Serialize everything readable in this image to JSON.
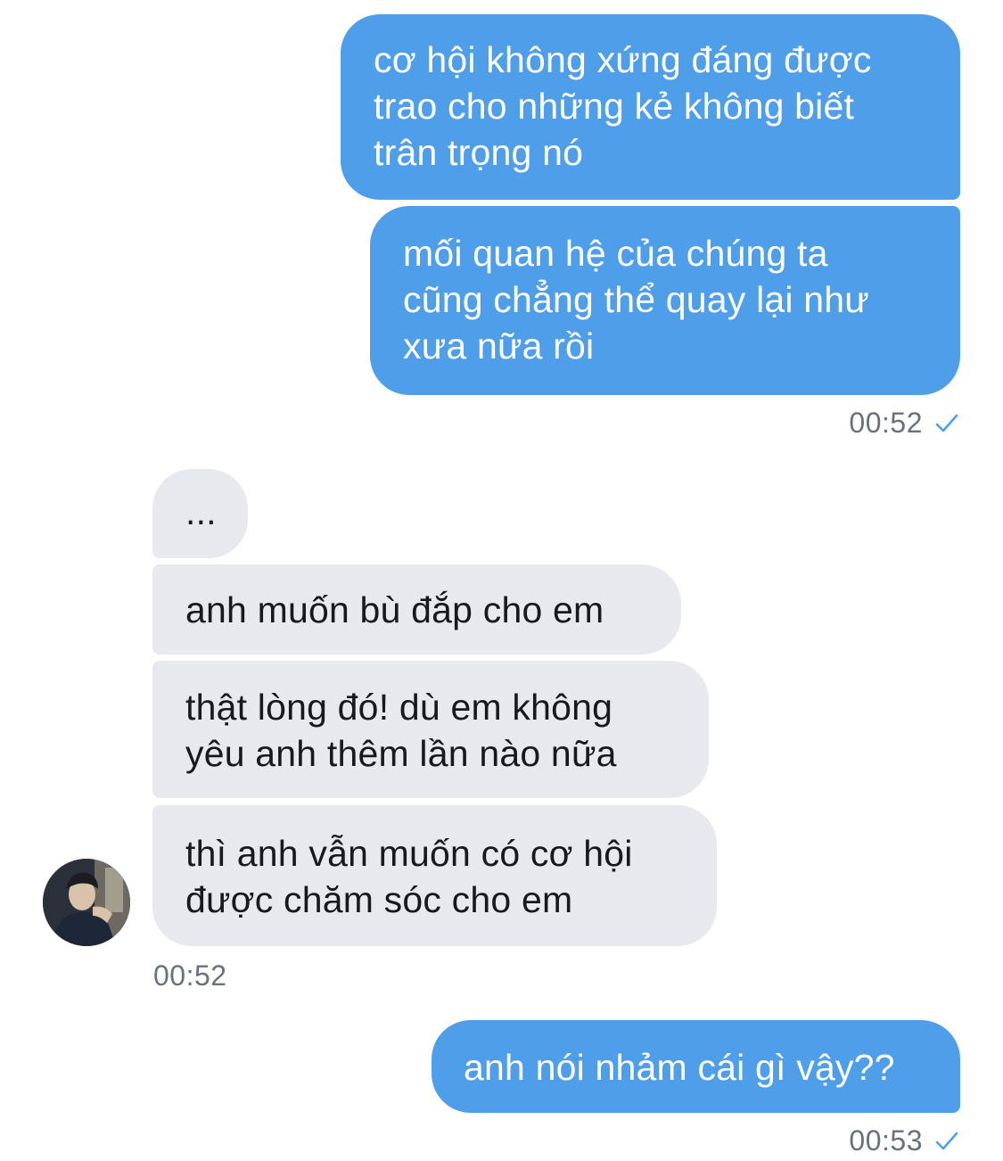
{
  "colors": {
    "outgoing_bubble": "#4e9ee9",
    "incoming_bubble": "#e7e9ee",
    "read_check": "#4e9ee9",
    "timestamp": "#69717a"
  },
  "messages": [
    {
      "text": "cơ hội không xứng đáng được\ntrao cho những kẻ không biết\ntrân trọng nó"
    },
    {
      "text": "mối quan hệ của chúng ta\ncũng chẳng thể quay lại như\nxưa nữa rồi"
    },
    {
      "text": "..."
    },
    {
      "text": "anh muốn bù đắp cho em"
    },
    {
      "text": "thật lòng đó! dù em không\nyêu anh thêm lần nào nữa"
    },
    {
      "text": "thì anh vẫn muốn có cơ hội\nđược chăm sóc cho em"
    },
    {
      "text": "anh nói nhảm cái gì vậy??"
    }
  ],
  "timestamps": {
    "group1": "00:52",
    "group2": "00:52",
    "group3": "00:53"
  },
  "icons": {
    "read_receipt": "checkmark-icon",
    "avatar": "user-avatar"
  }
}
